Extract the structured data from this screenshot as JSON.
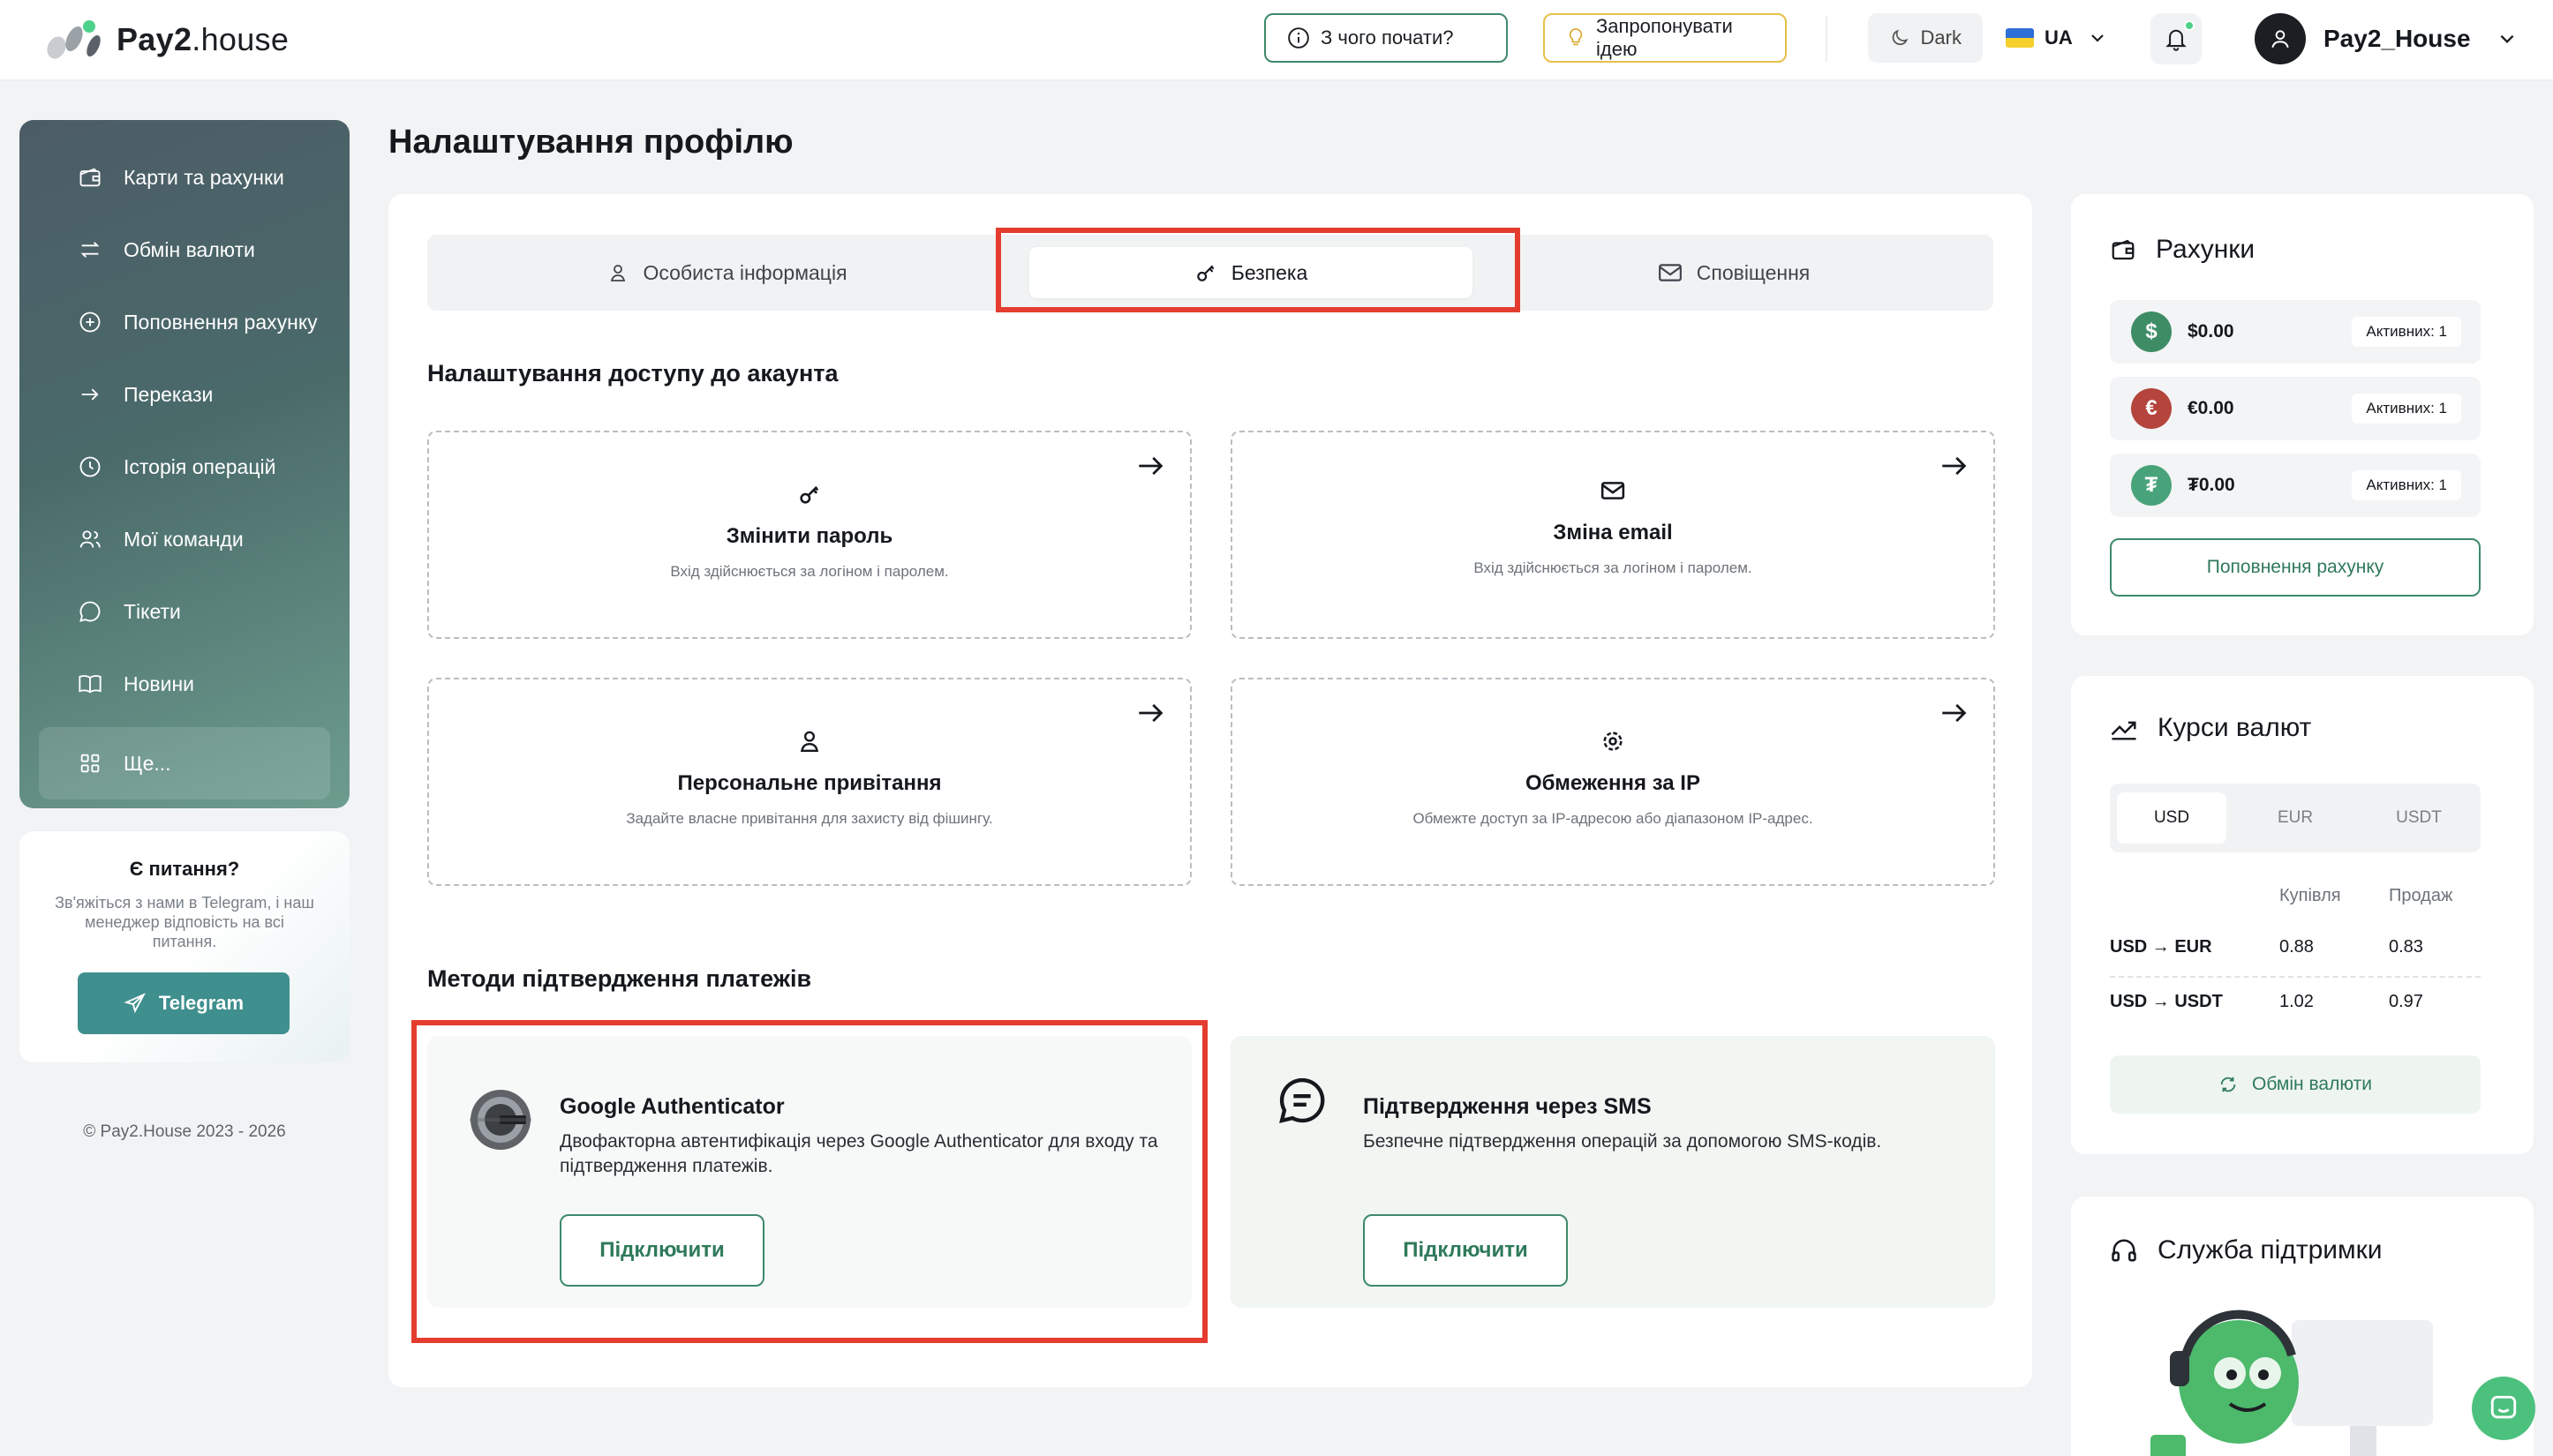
{
  "header": {
    "logo_text_bold": "Pay2",
    "logo_text_light": ".house",
    "start_label": "З чого почати?",
    "idea_label": "Запропонувати ідею",
    "theme_label": "Dark",
    "lang_label": "UA",
    "user_name": "Pay2_House"
  },
  "sidebar": {
    "items": [
      {
        "label": "Карти та рахунки",
        "icon": "wallet-icon"
      },
      {
        "label": "Обмін валюти",
        "icon": "exchange-icon"
      },
      {
        "label": "Поповнення рахунку",
        "icon": "plus-circle-icon"
      },
      {
        "label": "Перекази",
        "icon": "arrow-right-icon"
      },
      {
        "label": "Історія операцій",
        "icon": "clock-icon"
      },
      {
        "label": "Мої команди",
        "icon": "users-icon"
      },
      {
        "label": "Тікети",
        "icon": "chat-icon"
      },
      {
        "label": "Новини",
        "icon": "book-icon"
      },
      {
        "label": "Ще...",
        "icon": "grid-icon"
      }
    ]
  },
  "help": {
    "title": "Є питання?",
    "text": "Зв'яжіться з нами в Telegram, і наш менеджер відповість на всі питання.",
    "button": "Telegram"
  },
  "copyright": "© Pay2.House 2023 - 2026",
  "main": {
    "title": "Налаштування профілю",
    "tabs": [
      {
        "label": "Особиста інформація"
      },
      {
        "label": "Безпека"
      },
      {
        "label": "Сповіщення"
      }
    ],
    "access_title": "Налаштування доступу до акаунта",
    "options": [
      {
        "title": "Змінити пароль",
        "desc": "Вхід здійснюється за логіном і паролем."
      },
      {
        "title": "Зміна email",
        "desc": "Вхід здійснюється за логіном і паролем."
      },
      {
        "title": "Персональне привітання",
        "desc": "Задайте власне привітання для захисту від фішингу."
      },
      {
        "title": "Обмеження за IP",
        "desc": "Обмежте доступ за IP-адресою або діапазоном IP-адрес."
      }
    ],
    "methods_title": "Методи підтвердження платежів",
    "methods": [
      {
        "title": "Google Authenticator",
        "desc": "Двофакторна автентифікація через Google Authenticator для входу та підтвердження платежів.",
        "button": "Підключити"
      },
      {
        "title": "Підтвердження через SMS",
        "desc": "Безпечне підтвердження операцій за допомогою SMS-кодів.",
        "button": "Підключити"
      }
    ]
  },
  "accounts": {
    "title": "Рахунки",
    "rows": [
      {
        "symbol": "$",
        "amount": "$0.00",
        "badge": "Активних: 1",
        "color": "#3e8c66"
      },
      {
        "symbol": "€",
        "amount": "€0.00",
        "badge": "Активних: 1",
        "color": "#b4443c"
      },
      {
        "symbol": "₮",
        "amount": "₮0.00",
        "badge": "Активних: 1",
        "color": "#49a37a"
      }
    ],
    "button": "Поповнення рахунку"
  },
  "rates": {
    "title": "Курси валют",
    "tabs": [
      "USD",
      "EUR",
      "USDT"
    ],
    "col_buy": "Купівля",
    "col_sell": "Продаж",
    "rows": [
      {
        "pair": "USD → EUR",
        "buy": "0.88",
        "sell": "0.83"
      },
      {
        "pair": "USD → USDT",
        "buy": "1.02",
        "sell": "0.97"
      }
    ],
    "button": "Обмін валюти"
  },
  "support": {
    "title": "Служба підтримки"
  },
  "colors": {
    "accent": "#3d8a6a",
    "highlight": "#e43d2f"
  }
}
